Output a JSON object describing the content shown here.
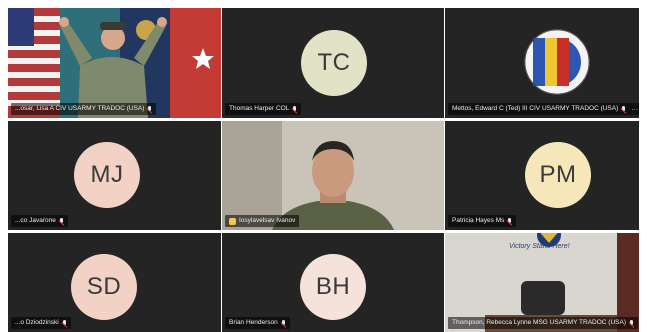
{
  "tiles": [
    {
      "id": "t1",
      "initials": "",
      "name": "...osar, Lisa A CIV USARMY TRADOC (USA)",
      "muted": true
    },
    {
      "id": "t2",
      "initials": "TC",
      "name": "Thomas Harper COL",
      "muted": true
    },
    {
      "id": "t3",
      "initials": "",
      "name": "Mettos, Edward C (Ted) III CIV USARMY TRADOC (USA)",
      "muted": true,
      "more": "…"
    },
    {
      "id": "t4",
      "initials": "MJ",
      "name": "...co Javarone",
      "muted": true
    },
    {
      "id": "t5",
      "initials": "",
      "name": "Iosylavelsav Ivanov",
      "muted": false
    },
    {
      "id": "t6",
      "initials": "PM",
      "name": "Patricia Hayes Ms",
      "muted": true
    },
    {
      "id": "t7",
      "initials": "SD",
      "name": "...o Dziodzinski",
      "muted": true
    },
    {
      "id": "t8",
      "initials": "BH",
      "name": "Brian Henderson",
      "muted": true
    },
    {
      "id": "t9",
      "initials": "",
      "name": "Thompson, Rebecca Lynne MSG USARMY TRADOC (USA)",
      "muted": true,
      "banner": "Victory Starts Here!"
    }
  ],
  "colors": {
    "tile_bg": "#242424",
    "avatar_tc": "#e2e2c6",
    "avatar_mj": "#f2d2c4",
    "avatar_pm": "#f5e7b9",
    "avatar_sd": "#f2d2c4",
    "avatar_bh": "#f4e2db"
  },
  "logo_text": "INTERNATIONAL ARMY PROGRAMS"
}
